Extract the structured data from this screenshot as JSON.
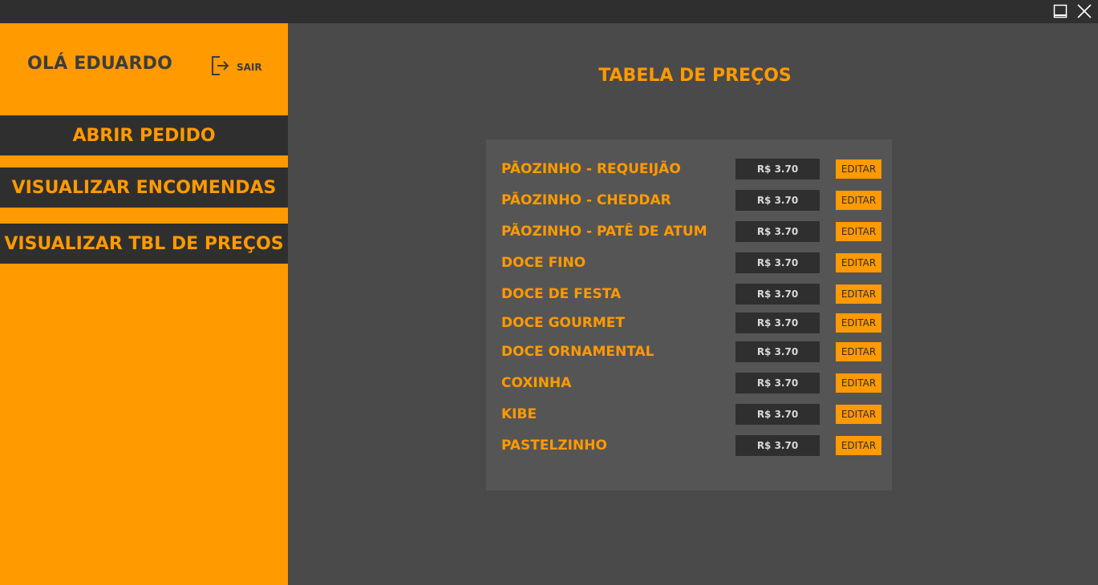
{
  "window": {
    "controls": [
      "minimize-icon",
      "close-icon"
    ]
  },
  "sidebar": {
    "greeting": "OLÁ EDUARDO",
    "logout_label": "SAIR",
    "logout_icon": "logout-icon",
    "nav": [
      {
        "label": "ABRIR PEDIDO"
      },
      {
        "label": "VISUALIZAR ENCOMENDAS"
      },
      {
        "label": "VISUALIZAR TBL DE PREÇOS"
      }
    ]
  },
  "main": {
    "title": "TABELA DE PREÇOS",
    "edit_label": "EDITAR",
    "items": [
      {
        "name": "PÃOZINHO - REQUEIJÃO",
        "price": "R$ 3.70"
      },
      {
        "name": "PÃOZINHO - CHEDDAR",
        "price": "R$ 3.70"
      },
      {
        "name": "PÃOZINHO - PATÊ DE ATUM",
        "price": "R$ 3.70"
      },
      {
        "name": "DOCE FINO",
        "price": "R$ 3.70"
      },
      {
        "name": "DOCE DE FESTA",
        "price": "R$ 3.70"
      },
      {
        "name": "DOCE GOURMET",
        "price": "R$ 3.70"
      },
      {
        "name": "DOCE ORNAMENTAL",
        "price": "R$ 3.70"
      },
      {
        "name": "COXINHA",
        "price": "R$ 3.70"
      },
      {
        "name": "KIBE",
        "price": "R$ 3.70"
      },
      {
        "name": "PASTELZINHO",
        "price": "R$ 3.70"
      }
    ]
  },
  "colors": {
    "accent": "#ff9a00",
    "dark": "#2f2f2f",
    "background": "#4a4a4a",
    "panel": "#555555"
  }
}
